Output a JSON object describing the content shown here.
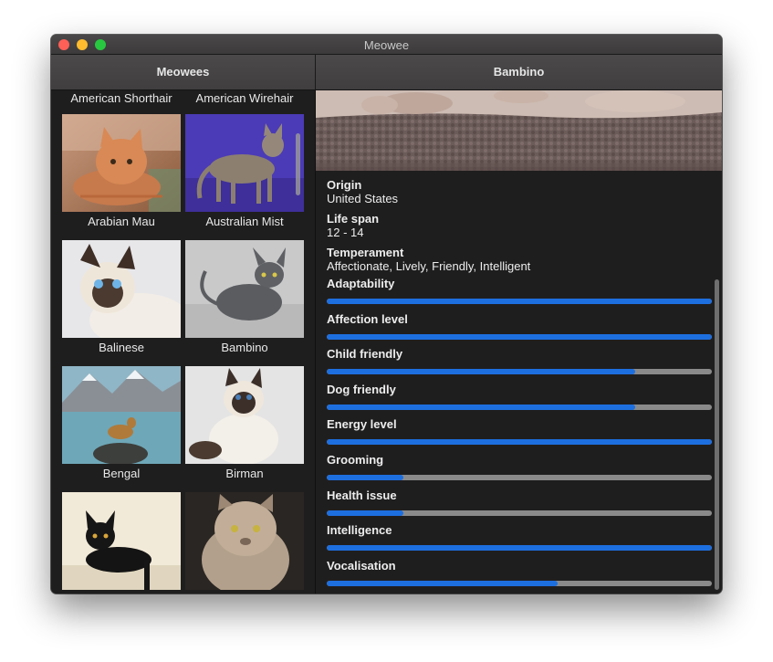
{
  "window": {
    "title": "Meowee"
  },
  "header": {
    "left_title": "Meowees",
    "right_title": "Bambino"
  },
  "sidebar": {
    "top_labels": [
      "American Shorthair",
      "American Wirehair"
    ],
    "cells": [
      {
        "label": "Arabian Mau",
        "image_icon": "orange-tabby-cat-photo"
      },
      {
        "label": "Australian Mist",
        "image_icon": "tabby-cat-standing-photo"
      },
      {
        "label": "Balinese",
        "image_icon": "siamese-cat-photo"
      },
      {
        "label": "Bambino",
        "image_icon": "sphynx-cat-photo"
      },
      {
        "label": "Bengal",
        "image_icon": "bengal-cat-lake-photo"
      },
      {
        "label": "Birman",
        "image_icon": "birman-cat-photo"
      },
      {
        "label": "",
        "image_icon": "black-cat-photo"
      },
      {
        "label": "",
        "image_icon": "persian-cat-photo"
      }
    ]
  },
  "detail": {
    "hero_icon": "cat-on-fur-blanket-photo",
    "fields": [
      {
        "title": "Origin",
        "value": "United States"
      },
      {
        "title": "Life span",
        "value": "12 - 14"
      },
      {
        "title": "Temperament",
        "value": "Affectionate, Lively, Friendly, Intelligent"
      }
    ],
    "stats": [
      {
        "label": "Adaptability",
        "level": 1.0
      },
      {
        "label": "Affection level",
        "level": 1.0
      },
      {
        "label": "Child friendly",
        "level": 0.8
      },
      {
        "label": "Dog friendly",
        "level": 0.8
      },
      {
        "label": "Energy level",
        "level": 1.0
      },
      {
        "label": "Grooming",
        "level": 0.2
      },
      {
        "label": "Health issue",
        "level": 0.2
      },
      {
        "label": "Intelligence",
        "level": 1.0
      },
      {
        "label": "Vocalisation",
        "level": 0.6
      }
    ]
  },
  "colors": {
    "accent": "#1d6fe0",
    "track": "#8a8a8a",
    "background": "#1f1e1f"
  }
}
